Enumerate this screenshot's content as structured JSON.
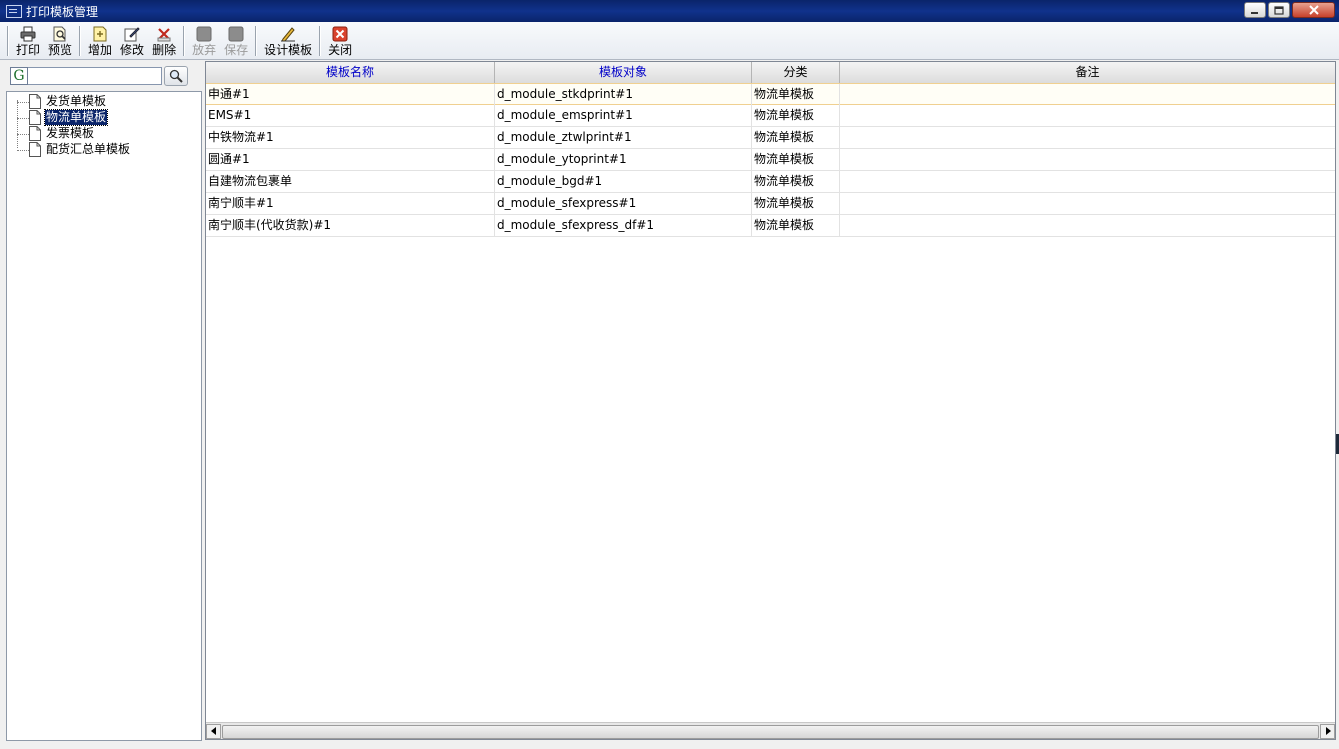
{
  "window": {
    "title": "打印模板管理"
  },
  "toolbar": {
    "buttons": [
      {
        "label": "打印",
        "icon": "printer-icon",
        "enabled": true
      },
      {
        "label": "预览",
        "icon": "preview-icon",
        "enabled": true
      },
      {
        "label": "增加",
        "icon": "add-icon",
        "enabled": true
      },
      {
        "label": "修改",
        "icon": "edit-icon",
        "enabled": true
      },
      {
        "label": "删除",
        "icon": "delete-icon",
        "enabled": true
      },
      {
        "label": "放弃",
        "icon": "discard-icon",
        "enabled": false
      },
      {
        "label": "保存",
        "icon": "save-icon",
        "enabled": false
      },
      {
        "label": "设计模板",
        "icon": "design-icon",
        "enabled": true
      },
      {
        "label": "关闭",
        "icon": "close-icon",
        "enabled": true
      }
    ]
  },
  "search": {
    "value": "",
    "prefix_icon": "g-icon",
    "button_icon": "search-icon"
  },
  "tree": {
    "items": [
      {
        "label": "发货单模板",
        "selected": false
      },
      {
        "label": "物流单模板",
        "selected": true
      },
      {
        "label": "发票模板",
        "selected": false
      },
      {
        "label": "配货汇总单模板",
        "selected": false
      }
    ]
  },
  "grid": {
    "columns": [
      "模板名称",
      "模板对象",
      "分类",
      "备注"
    ],
    "rows": [
      [
        "申通#1",
        "d_module_stkdprint#1",
        "物流单模板",
        ""
      ],
      [
        "EMS#1",
        "d_module_emsprint#1",
        "物流单模板",
        ""
      ],
      [
        "中铁物流#1",
        "d_module_ztwlprint#1",
        "物流单模板",
        ""
      ],
      [
        "圆通#1",
        "d_module_ytoprint#1",
        "物流单模板",
        ""
      ],
      [
        "自建物流包裹单",
        "d_module_bgd#1",
        "物流单模板",
        ""
      ],
      [
        "南宁顺丰#1",
        "d_module_sfexpress#1",
        "物流单模板",
        ""
      ],
      [
        "南宁顺丰(代收货款)#1",
        "d_module_sfexpress_df#1",
        "物流单模板",
        ""
      ]
    ]
  },
  "colors": {
    "titlebar": "#0a246a",
    "header_blue_text": "#0000c8",
    "selection": "#0a246a"
  }
}
